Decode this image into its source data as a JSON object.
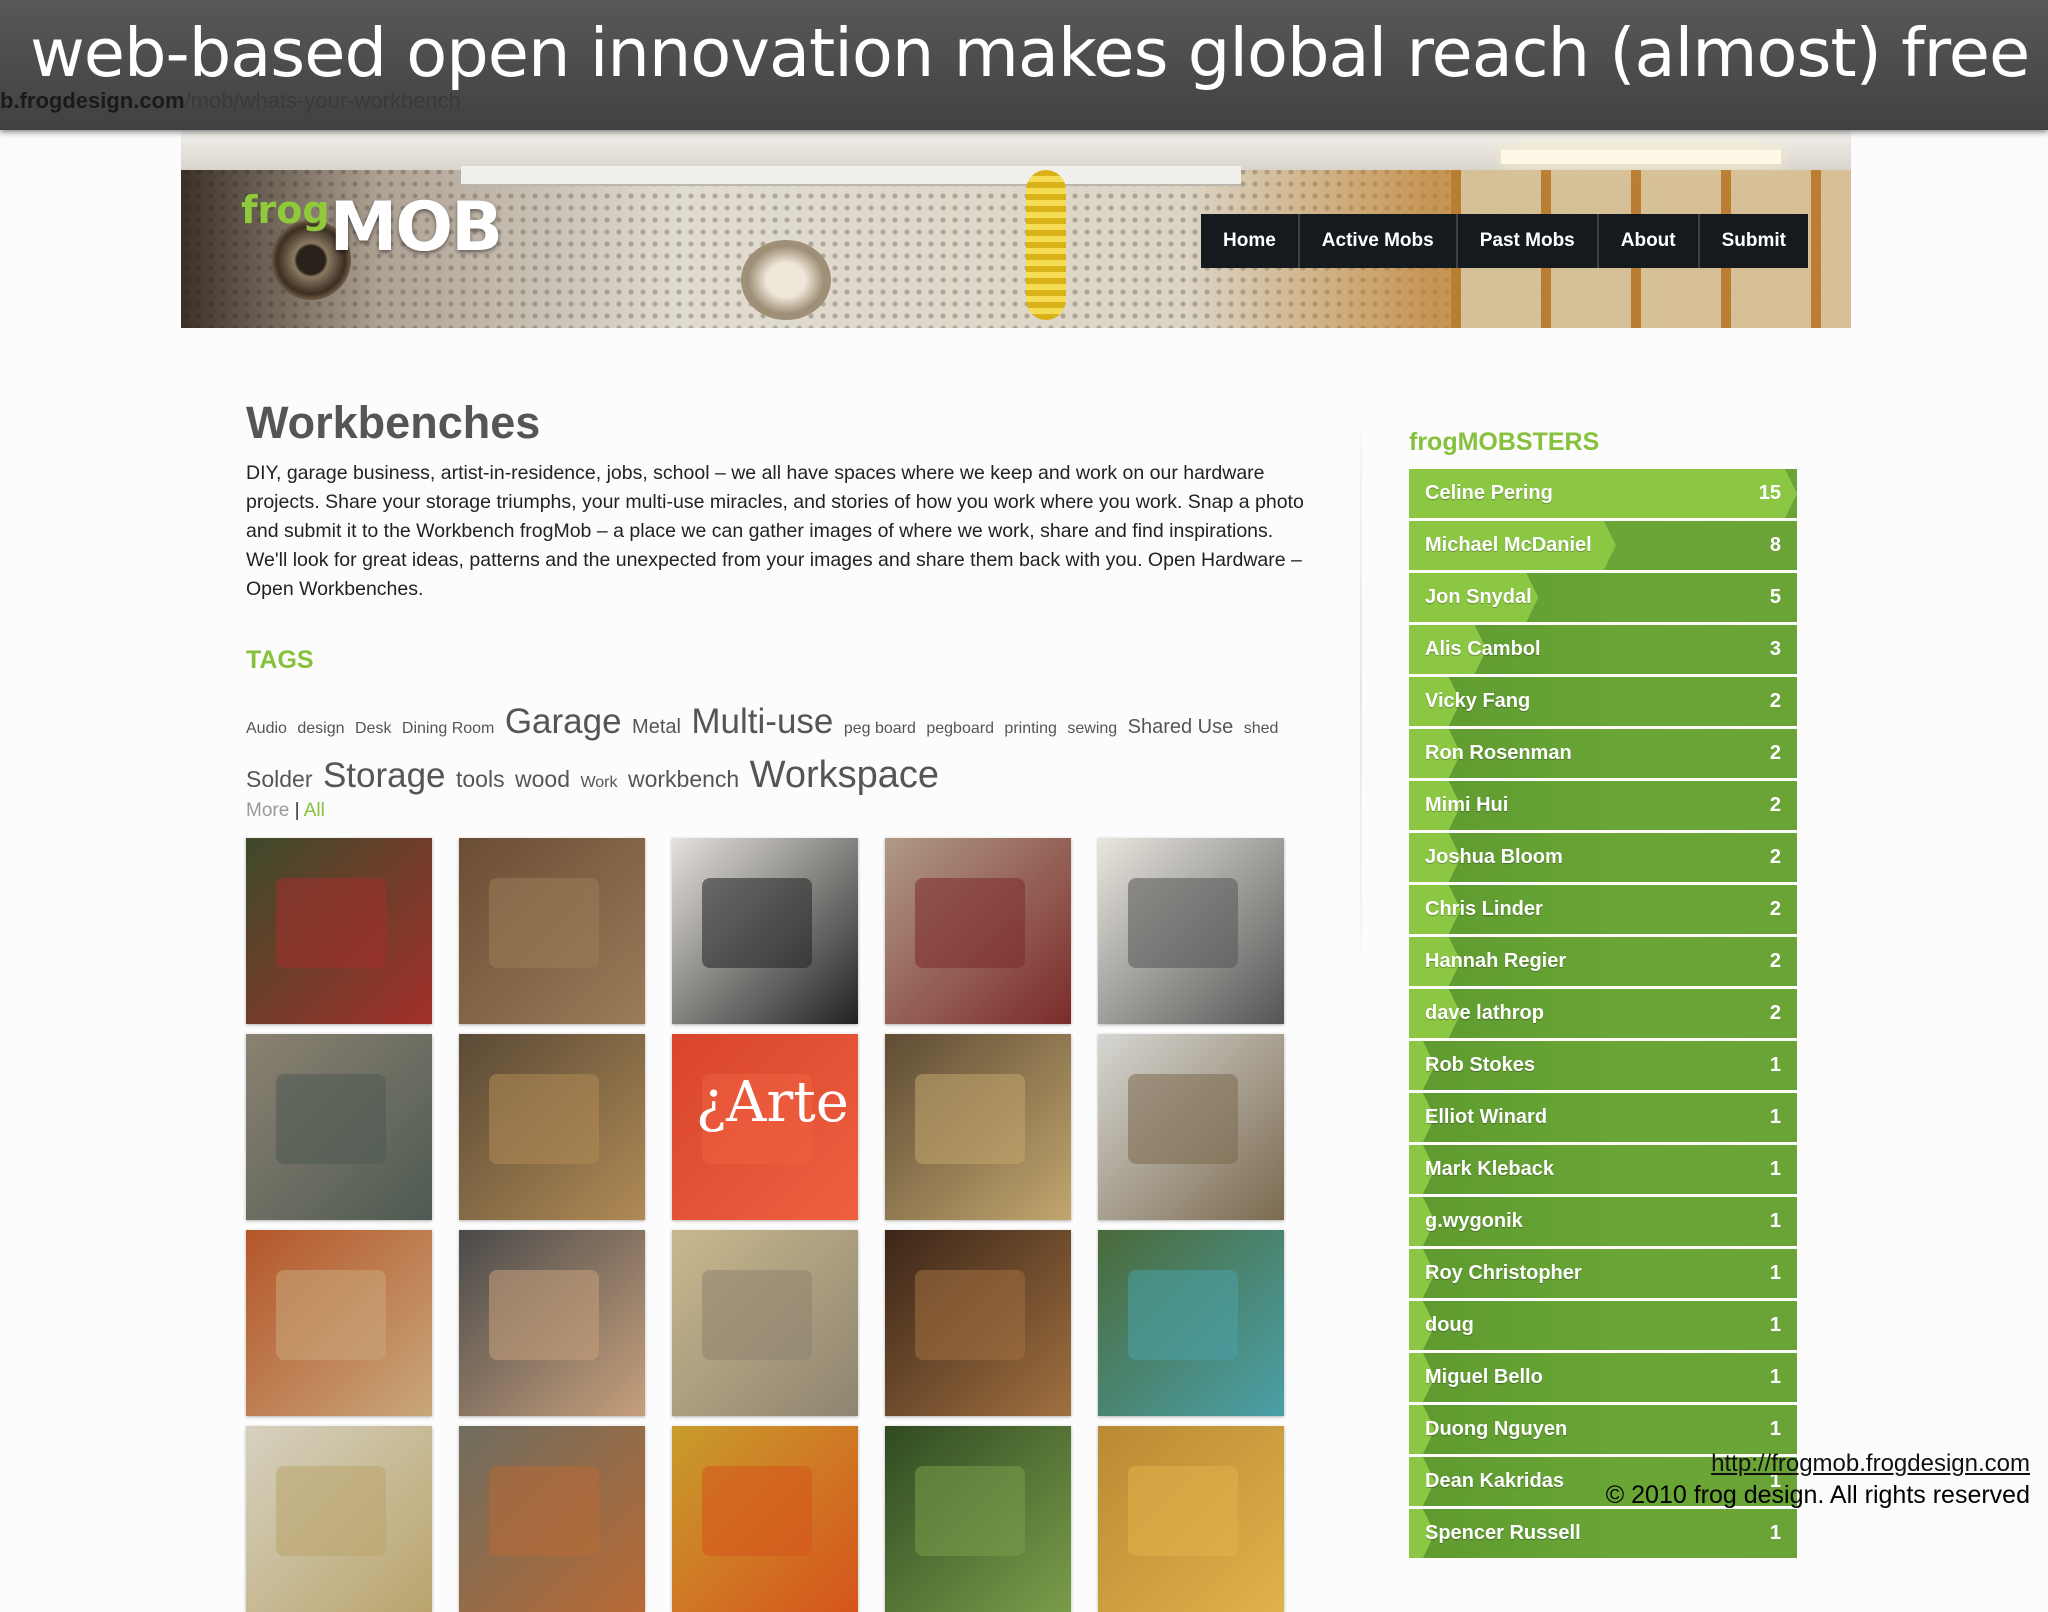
{
  "slide": {
    "title": "web-based open innovation makes global reach (almost) free",
    "url_host": "b.frogdesign.com",
    "url_path": "/mob/whats-your-workbench"
  },
  "site": {
    "logo_frog": "frog",
    "logo_mob": "MOB",
    "nav": [
      "Home",
      "Active Mobs",
      "Past Mobs",
      "About",
      "Submit"
    ]
  },
  "page": {
    "title": "Workbenches",
    "intro": "DIY, garage business, artist-in-residence, jobs, school – we all have spaces where we keep and work on our hardware projects. Share your storage triumphs, your multi-use miracles, and stories of how you work where you work. Snap a photo and submit it to the Workbench frogMob – a place we can gather images of where we work, share and find inspirations. We'll look for great ideas, patterns and the unexpected from your images and share them back with you. Open Hardware – Open Workbenches.",
    "tags_heading": "TAGS",
    "tags": [
      {
        "label": "Audio",
        "size": "t1"
      },
      {
        "label": "design",
        "size": "t1"
      },
      {
        "label": "Desk",
        "size": "t1"
      },
      {
        "label": "Dining Room",
        "size": "t1"
      },
      {
        "label": "Garage",
        "size": "t4"
      },
      {
        "label": "Metal",
        "size": "t2"
      },
      {
        "label": "Multi-use",
        "size": "t4"
      },
      {
        "label": "peg board",
        "size": "t1"
      },
      {
        "label": "pegboard",
        "size": "t1"
      },
      {
        "label": "printing",
        "size": "t1"
      },
      {
        "label": "sewing",
        "size": "t1"
      },
      {
        "label": "Shared Use",
        "size": "t2"
      },
      {
        "label": "shed",
        "size": "t1"
      },
      {
        "label": "Solder",
        "size": "t3"
      },
      {
        "label": "Storage",
        "size": "t4"
      },
      {
        "label": "tools",
        "size": "t3"
      },
      {
        "label": "wood",
        "size": "t3"
      },
      {
        "label": "Work",
        "size": "t1"
      },
      {
        "label": "workbench",
        "size": "t3"
      },
      {
        "label": "Workspace",
        "size": "t5"
      }
    ],
    "more_label": "More",
    "separator": "|",
    "all_label": "All"
  },
  "gallery": {
    "arte_text": "¿Arte",
    "photos": [
      {
        "name": "workbench-photo-red-figure",
        "bg": "#3d4a2a",
        "accent": "#a3302a"
      },
      {
        "name": "workbench-photo-tool-rack",
        "bg": "#6a4d35",
        "accent": "#9c7b58"
      },
      {
        "name": "workbench-photo-wrench-wall",
        "bg": "#e6e3de",
        "accent": "#222222"
      },
      {
        "name": "workbench-photo-sewing-corner",
        "bg": "#b09a86",
        "accent": "#7b2b2a"
      },
      {
        "name": "workbench-photo-pegboard-tools",
        "bg": "#e9e6df",
        "accent": "#555555"
      },
      {
        "name": "workbench-photo-bandsaw",
        "bg": "#8b8272",
        "accent": "#4e5a52"
      },
      {
        "name": "workbench-photo-garage-bench",
        "bg": "#5a4a36",
        "accent": "#b08a55"
      },
      {
        "name": "workbench-photo-arte-bus",
        "bg": "#d8452c",
        "accent": "#f06040"
      },
      {
        "name": "workbench-photo-bookshelf",
        "bg": "#5e4c34",
        "accent": "#c2a66e"
      },
      {
        "name": "workbench-photo-office-room",
        "bg": "#d6d6d2",
        "accent": "#7b6a4f"
      },
      {
        "name": "workbench-photo-wood-shop",
        "bg": "#b4562a",
        "accent": "#c8a77a"
      },
      {
        "name": "workbench-photo-cat-desk",
        "bg": "#4a4a4a",
        "accent": "#c7a07c"
      },
      {
        "name": "workbench-photo-kitchen-shop",
        "bg": "#c9b88e",
        "accent": "#8e8470"
      },
      {
        "name": "workbench-photo-dark-workshop",
        "bg": "#3b2618",
        "accent": "#a07040"
      },
      {
        "name": "workbench-photo-plant-table",
        "bg": "#4a6a3a",
        "accent": "#4aa0a8"
      },
      {
        "name": "workbench-photo-garage-shelves",
        "bg": "#d6d1c0",
        "accent": "#b9a46c"
      },
      {
        "name": "workbench-photo-loft-table",
        "bg": "#6f6d5f",
        "accent": "#b86a34"
      },
      {
        "name": "workbench-photo-yellow-shed",
        "bg": "#c89d2c",
        "accent": "#d6541c"
      },
      {
        "name": "workbench-photo-tree-yard",
        "bg": "#2f4a22",
        "accent": "#7a9d4a"
      },
      {
        "name": "workbench-photo-yellow-art",
        "bg": "#b98a34",
        "accent": "#e0b24a"
      }
    ]
  },
  "sidebar": {
    "title": "frogMOBSTERS",
    "members": [
      {
        "name": "Celine Pering",
        "count": 15
      },
      {
        "name": "Michael McDaniel",
        "count": 8
      },
      {
        "name": "Jon Snydal",
        "count": 5
      },
      {
        "name": "Alis Cambol",
        "count": 3
      },
      {
        "name": "Vicky Fang",
        "count": 2
      },
      {
        "name": "Ron Rosenman",
        "count": 2
      },
      {
        "name": "Mimi Hui",
        "count": 2
      },
      {
        "name": "Joshua Bloom",
        "count": 2
      },
      {
        "name": "Chris Linder",
        "count": 2
      },
      {
        "name": "Hannah Regier",
        "count": 2
      },
      {
        "name": "dave lathrop",
        "count": 2
      },
      {
        "name": "Rob Stokes",
        "count": 1
      },
      {
        "name": "Elliot Winard",
        "count": 1
      },
      {
        "name": "Mark Kleback",
        "count": 1
      },
      {
        "name": "g.wygonik",
        "count": 1
      },
      {
        "name": "Roy Christopher",
        "count": 1
      },
      {
        "name": "doug",
        "count": 1
      },
      {
        "name": "Miguel Bello",
        "count": 1
      },
      {
        "name": "Duong Nguyen",
        "count": 1
      },
      {
        "name": "Dean Kakridas",
        "count": 1
      },
      {
        "name": "Spencer Russell",
        "count": 1
      }
    ]
  },
  "credit": {
    "url": "http://frogmob.frogdesign.com",
    "copyright": "© 2010 frog design. All rights reserved"
  },
  "colors": {
    "accent_green": "#86c13c",
    "nav_bg": "#151a1e",
    "slide_bar": "#4a4a4c"
  }
}
